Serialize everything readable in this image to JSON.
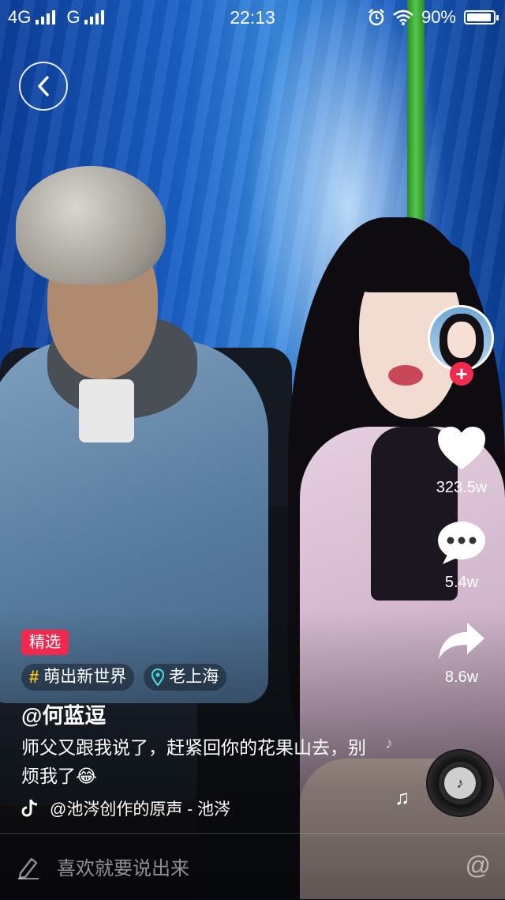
{
  "status_bar": {
    "net1": "4G",
    "net2": "G",
    "time": "22:13",
    "battery": "90%"
  },
  "video": {
    "badge": "精选",
    "topic": "萌出新世界",
    "location": "老上海",
    "author": "@何蓝逗",
    "caption": "师父又跟我说了，赶紧回你的花果山去，别烦我了😂",
    "music": "@池涔创作的原声 - 池涔"
  },
  "actions": {
    "likes": "323.5w",
    "comments": "5.4w",
    "shares": "8.6w"
  },
  "comment": {
    "placeholder": "喜欢就要说出来"
  },
  "colors": {
    "accent": "#f1294e",
    "topic_hash": "#f7c61e",
    "location_pin": "#3fd6e0"
  }
}
